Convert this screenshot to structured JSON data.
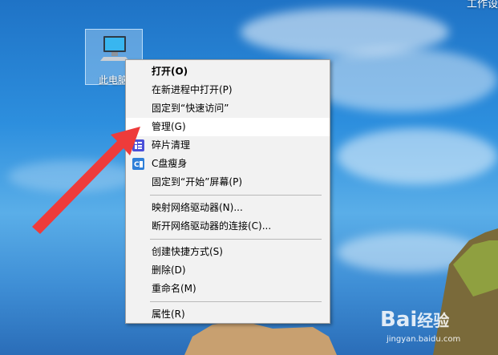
{
  "desktop": {
    "icon_label": "此电脑",
    "top_right_text": "工作设"
  },
  "context_menu": {
    "items": [
      {
        "label": "打开(O)",
        "bold": true
      },
      {
        "label": "在新进程中打开(P)"
      },
      {
        "label": "固定到“快速访问”"
      },
      {
        "label": "管理(G)",
        "highlighted": true
      },
      {
        "label": "碎片清理",
        "icon": "defrag-icon"
      },
      {
        "label": "C盘瘦身",
        "icon": "disk-cleanup-icon"
      },
      {
        "label": "固定到“开始”屏幕(P)"
      },
      {
        "label": "映射网络驱动器(N)..."
      },
      {
        "label": "断开网络驱动器的连接(C)..."
      },
      {
        "label": "创建快捷方式(S)"
      },
      {
        "label": "删除(D)"
      },
      {
        "label": "重命名(M)"
      },
      {
        "label": "属性(R)"
      }
    ]
  },
  "annotation": {
    "arrow_color": "#ee3b3b"
  },
  "watermark": {
    "brand": "Bai",
    "brand2": "经验",
    "url": "jingyan.baidu.com"
  }
}
